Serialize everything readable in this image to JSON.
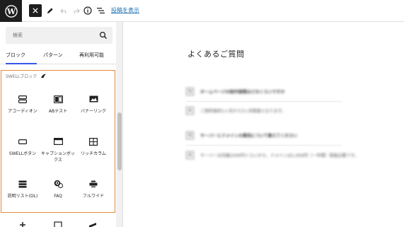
{
  "toolbar": {
    "view_post_link": "投稿を表示"
  },
  "inserter": {
    "search_placeholder": "検索",
    "tabs": [
      {
        "label": "ブロック",
        "active": true
      },
      {
        "label": "パターン",
        "active": false
      },
      {
        "label": "再利用可能",
        "active": false
      }
    ],
    "section_title": "SWELLブロック",
    "blocks": [
      {
        "label": "アコーディオン",
        "icon": "accordion-icon"
      },
      {
        "label": "ABテスト",
        "icon": "ab-test-icon"
      },
      {
        "label": "バナーリンク",
        "icon": "banner-link-icon"
      },
      {
        "label": "SWELLボタン",
        "icon": "swell-button-icon"
      },
      {
        "label": "キャプションボックス",
        "icon": "caption-box-icon"
      },
      {
        "label": "リッチカラム",
        "icon": "rich-column-icon"
      },
      {
        "label": "説明リスト(DL)",
        "icon": "description-list-icon"
      },
      {
        "label": "FAQ",
        "icon": "faq-icon"
      },
      {
        "label": "フルワイド",
        "icon": "full-wide-icon"
      }
    ],
    "highlight_color": "#e8893a"
  },
  "editor": {
    "heading": "よくあるご質問",
    "faq": [
      {
        "q": "Q",
        "text": "ホームページの制作期間はどのくらいですか",
        "a": "A",
        "answer": "ご契約後約1ヶ月から3ヶ月程度となります。"
      },
      {
        "q": "Q",
        "text": "サーバーとドメインの費用について教えてください",
        "a": "A",
        "answer": "サーバーは月額1000円くらいから、ドメインは1,000円（一年間）程度必要です。"
      }
    ]
  },
  "colors": {
    "accent": "#3858e9",
    "link": "#2271b1"
  }
}
